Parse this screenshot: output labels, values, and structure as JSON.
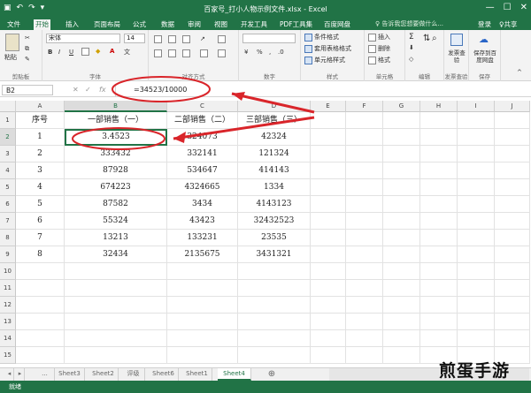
{
  "window": {
    "title": "百家号_打小人物示例文件.xlsx - Excel",
    "login": "登录",
    "share": "♀共享",
    "minimize": "—",
    "restore": "☐",
    "close": "✕"
  },
  "ribbon_tabs": [
    "文件",
    "开始",
    "插入",
    "页面布局",
    "公式",
    "数据",
    "审阅",
    "视图",
    "开发工具",
    "PDF工具集",
    "百度网盘"
  ],
  "tell_me": "♀ 告诉我您想要做什么...",
  "ribbon": {
    "clipboard": {
      "paste": "粘贴",
      "label": "剪贴板"
    },
    "font": {
      "name": "宋体",
      "size": "14",
      "bold": "B",
      "italic": "I",
      "underline": "U",
      "label": "字体"
    },
    "alignment": {
      "label": "对齐方式"
    },
    "number": {
      "percent": "%",
      "label": "数字"
    },
    "styles": {
      "conditional": "条件格式",
      "table": "套用表格格式",
      "cell": "单元格样式",
      "label": "样式"
    },
    "cells": {
      "insert": "插入",
      "delete": "删除",
      "format": "格式",
      "label": "单元格"
    },
    "editing": {
      "label": "编辑"
    },
    "invoice": {
      "btn": "发票查验",
      "label": "发票查验"
    },
    "baidu": {
      "btn": "保存到百度网盘",
      "label": "保存"
    }
  },
  "formula_bar": {
    "name_box": "B2",
    "cancel": "✕",
    "enter": "✓",
    "fx": "fx",
    "formula": "=34523/10000"
  },
  "columns": [
    "A",
    "B",
    "C",
    "D",
    "E",
    "F",
    "G",
    "H",
    "I",
    "J"
  ],
  "rows": [
    "1",
    "2",
    "3",
    "4",
    "5",
    "6",
    "7",
    "8",
    "9",
    "10",
    "11",
    "12",
    "13",
    "14",
    "15"
  ],
  "table": {
    "headers": [
      "序号",
      "一部销售（一）",
      "二部销售（二）",
      "三部销售（三）"
    ],
    "data": [
      [
        "1",
        "3.4523",
        "324073",
        "42324"
      ],
      [
        "2",
        "333432",
        "332141",
        "121324"
      ],
      [
        "3",
        "87928",
        "534647",
        "414143"
      ],
      [
        "4",
        "674223",
        "4324665",
        "1334"
      ],
      [
        "5",
        "87582",
        "3434",
        "4143123"
      ],
      [
        "6",
        "55324",
        "43423",
        "32432523"
      ],
      [
        "7",
        "13213",
        "133231",
        "23535"
      ],
      [
        "8",
        "32434",
        "2135675",
        "3431321"
      ]
    ]
  },
  "sheet_tabs": [
    "...",
    "Sheet3",
    "Sheet2",
    "评级",
    "Sheet6",
    "Sheet1",
    "Sheet4"
  ],
  "active_sheet": "Sheet4",
  "status": "就绪",
  "watermark": "煎蛋手游",
  "colors": {
    "excel_green": "#217346",
    "annotation_red": "#d9252a"
  }
}
